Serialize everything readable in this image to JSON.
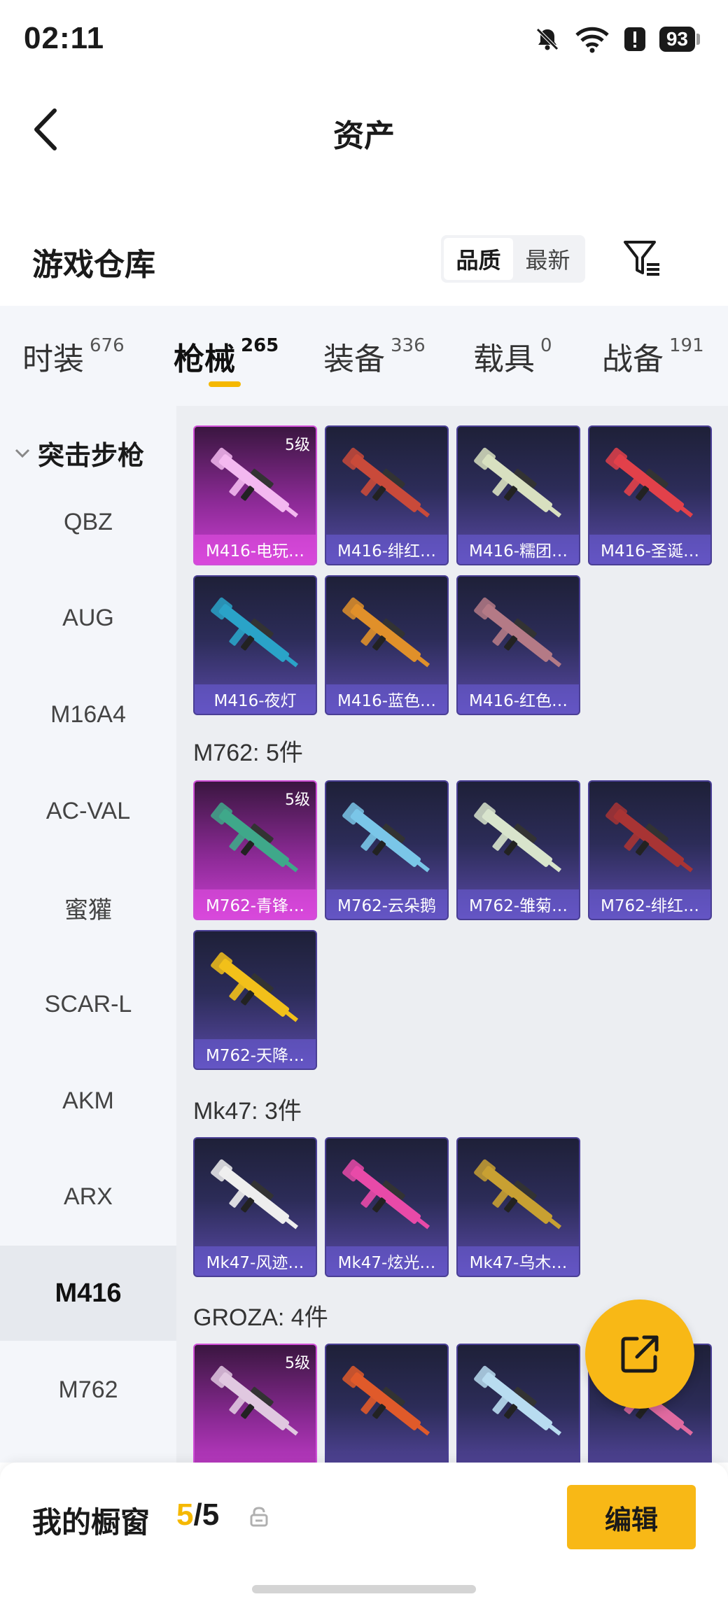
{
  "status_bar": {
    "time": "02:11",
    "battery": "93"
  },
  "header": {
    "title": "资产"
  },
  "warehouse": {
    "title": "游戏仓库",
    "sort_options": [
      "品质",
      "最新"
    ],
    "sort_selected": "品质"
  },
  "tabs": [
    {
      "label": "时装",
      "count": "676"
    },
    {
      "label": "枪械",
      "count": "265",
      "active": true
    },
    {
      "label": "装备",
      "count": "336"
    },
    {
      "label": "载具",
      "count": "0"
    },
    {
      "label": "战备",
      "count": "191"
    }
  ],
  "sidebar": {
    "group": "突击步枪",
    "items": [
      "QBZ",
      "AUG",
      "M16A4",
      "AC-VAL",
      "蜜獾",
      "SCAR-L",
      "AKM",
      "ARX",
      "M416",
      "M762"
    ],
    "selected": "M416"
  },
  "sections": [
    {
      "label": "",
      "items": [
        {
          "name": "M416-电玩…",
          "level": "5级",
          "color": "#8c2a96",
          "gun_color": "#f3b8f0"
        },
        {
          "name": "M416-绯红…",
          "color": "#2c2c58",
          "gun_color": "#c94a3a"
        },
        {
          "name": "M416-糯团…",
          "color": "#2c2c58",
          "gun_color": "#d8e0c0"
        },
        {
          "name": "M416-圣诞…",
          "color": "#2c2c58",
          "gun_color": "#e2414a"
        },
        {
          "name": "M416-夜灯",
          "color": "#2c2c58",
          "gun_color": "#2aa3c8"
        },
        {
          "name": "M416-蓝色…",
          "color": "#2c2c58",
          "gun_color": "#e0902a"
        },
        {
          "name": "M416-红色…",
          "color": "#2c2c58",
          "gun_color": "#b47a86"
        }
      ]
    },
    {
      "label": "M762: 5件",
      "items": [
        {
          "name": "M762-青锋…",
          "level": "5级",
          "color": "#8c2a96",
          "gun_color": "#3fa88a"
        },
        {
          "name": "M762-云朵鹅",
          "color": "#2c2c58",
          "gun_color": "#7ac6e8"
        },
        {
          "name": "M762-雏菊…",
          "color": "#2c2c58",
          "gun_color": "#d8e4cc"
        },
        {
          "name": "M762-绯红…",
          "color": "#2c2c58",
          "gun_color": "#a83434"
        },
        {
          "name": "M762-天降…",
          "color": "#2c2c58",
          "gun_color": "#f2c01a"
        }
      ]
    },
    {
      "label": "Mk47: 3件",
      "items": [
        {
          "name": "Mk47-风迹…",
          "color": "#2c2c58",
          "gun_color": "#eeeeee"
        },
        {
          "name": "Mk47-炫光…",
          "color": "#2c2c58",
          "gun_color": "#e84aa8"
        },
        {
          "name": "Mk47-乌木…",
          "color": "#2c2c58",
          "gun_color": "#c8a032"
        }
      ]
    },
    {
      "label": "GROZA: 4件",
      "items": [
        {
          "name": "",
          "level": "5级",
          "color": "#8c2a96",
          "gun_color": "#e0c8e0"
        },
        {
          "name": "",
          "color": "#2c2c58",
          "gun_color": "#e05a2a"
        },
        {
          "name": "",
          "color": "#2c2c58",
          "gun_color": "#b8dcf0"
        },
        {
          "name": "",
          "color": "#2c2c58",
          "gun_color": "#e06aa0"
        }
      ]
    }
  ],
  "showcase": {
    "label": "我的橱窗",
    "current": "5",
    "total": "/5",
    "edit_label": "编辑"
  },
  "colors": {
    "accent": "#f8b816",
    "tab_underline": "#f5b800",
    "gold_card": "#c93fd0",
    "normal_card": "#5a4aa8"
  }
}
